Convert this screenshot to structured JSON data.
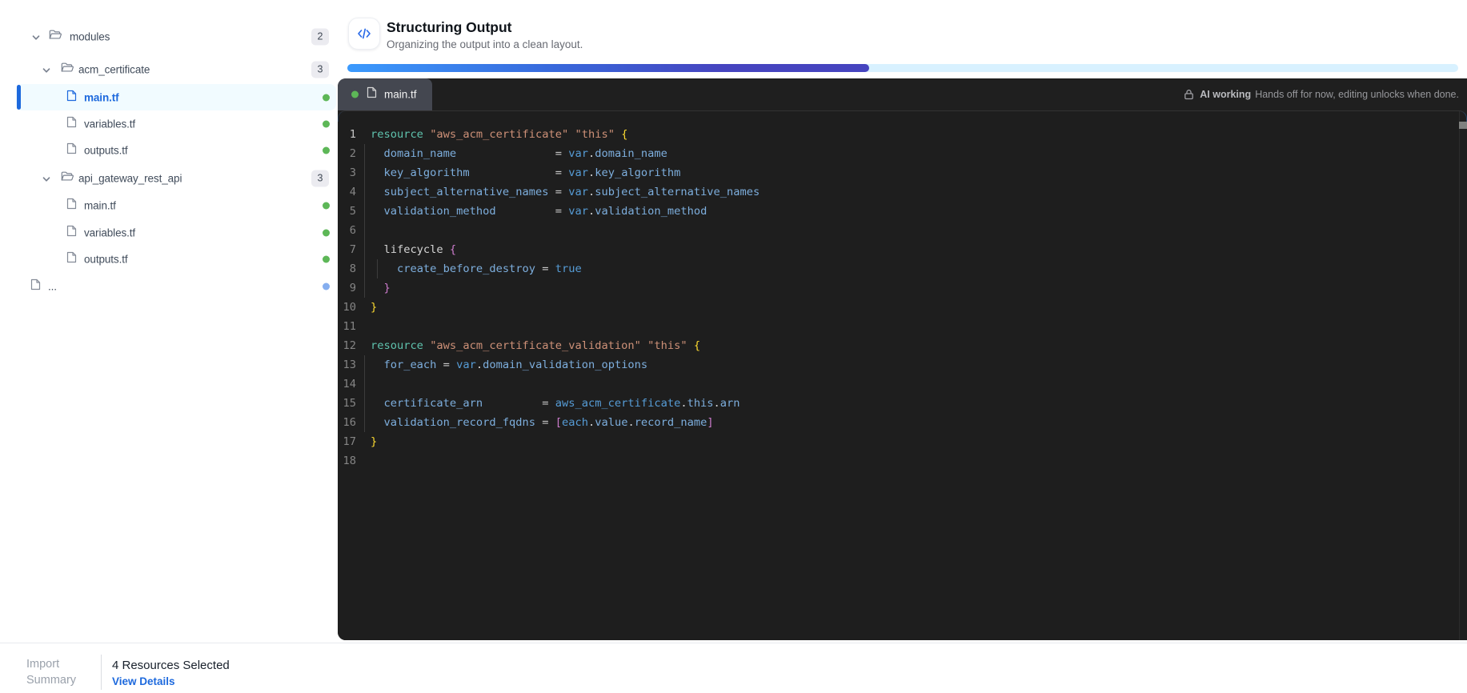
{
  "sidebar": {
    "tree": [
      {
        "type": "folder",
        "level": 0,
        "label": "modules",
        "badge": "2",
        "expanded": true
      },
      {
        "type": "folder",
        "level": 1,
        "label": "acm_certificate",
        "badge": "3",
        "expanded": true
      },
      {
        "type": "file",
        "level": 2,
        "label": "main.tf",
        "selected": true,
        "dot": "green"
      },
      {
        "type": "file",
        "level": 2,
        "label": "variables.tf",
        "dot": "green"
      },
      {
        "type": "file",
        "level": 2,
        "label": "outputs.tf",
        "dot": "green"
      },
      {
        "type": "folder",
        "level": 1,
        "label": "api_gateway_rest_api",
        "badge": "3",
        "expanded": true
      },
      {
        "type": "file",
        "level": 2,
        "label": "main.tf",
        "dot": "green"
      },
      {
        "type": "file",
        "level": 2,
        "label": "variables.tf",
        "dot": "green"
      },
      {
        "type": "file",
        "level": 2,
        "label": "outputs.tf",
        "dot": "green"
      },
      {
        "type": "file",
        "level": 0,
        "label": "...",
        "dot": "blue"
      }
    ]
  },
  "header": {
    "icon": "code-icon",
    "title": "Structuring Output",
    "subtitle": "Organizing the output into a clean layout.",
    "progress_percent": 47,
    "accent_gradient": [
      "#3b9afd",
      "#3868db",
      "#4644bf"
    ],
    "track_color": "#d8f1ff"
  },
  "editor": {
    "tab": {
      "label": "main.tf",
      "dot": "green",
      "icon": "file-icon"
    },
    "lock": {
      "icon": "lock-icon",
      "bold": "AI working",
      "text": "Hands off for now, editing unlocks when done."
    },
    "background": "#1e1e1e",
    "token_colors": {
      "kw": "#5fc3ae",
      "str": "#ce9178",
      "b1": "#fcda30",
      "b2": "#cd7ccd",
      "prop": "#7daedd",
      "ref": "#569cd6",
      "d": "#d4d4d4",
      "op": "#c8c8c8"
    },
    "lines": [
      {
        "n": 1,
        "active": true,
        "g": 0,
        "seg": [
          [
            "kw",
            "resource"
          ],
          [
            "d",
            " "
          ],
          [
            "str",
            "\"aws_acm_certificate\""
          ],
          [
            "d",
            " "
          ],
          [
            "str",
            "\"this\""
          ],
          [
            "d",
            " "
          ],
          [
            "b1",
            "{"
          ]
        ]
      },
      {
        "n": 2,
        "g": 1,
        "seg": [
          [
            "d",
            "  "
          ],
          [
            "prop",
            "domain_name"
          ],
          [
            "d",
            "               "
          ],
          [
            "op",
            "= "
          ],
          [
            "ref",
            "var"
          ],
          [
            "d",
            "."
          ],
          [
            "prop",
            "domain_name"
          ]
        ]
      },
      {
        "n": 3,
        "g": 1,
        "seg": [
          [
            "d",
            "  "
          ],
          [
            "prop",
            "key_algorithm"
          ],
          [
            "d",
            "             "
          ],
          [
            "op",
            "= "
          ],
          [
            "ref",
            "var"
          ],
          [
            "d",
            "."
          ],
          [
            "prop",
            "key_algorithm"
          ]
        ]
      },
      {
        "n": 4,
        "g": 1,
        "seg": [
          [
            "d",
            "  "
          ],
          [
            "prop",
            "subject_alternative_names"
          ],
          [
            "d",
            " "
          ],
          [
            "op",
            "= "
          ],
          [
            "ref",
            "var"
          ],
          [
            "d",
            "."
          ],
          [
            "prop",
            "subject_alternative_names"
          ]
        ]
      },
      {
        "n": 5,
        "g": 1,
        "seg": [
          [
            "d",
            "  "
          ],
          [
            "prop",
            "validation_method"
          ],
          [
            "d",
            "         "
          ],
          [
            "op",
            "= "
          ],
          [
            "ref",
            "var"
          ],
          [
            "d",
            "."
          ],
          [
            "prop",
            "validation_method"
          ]
        ]
      },
      {
        "n": 6,
        "g": 1,
        "seg": []
      },
      {
        "n": 7,
        "g": 1,
        "seg": [
          [
            "d",
            "  lifecycle "
          ],
          [
            "b2",
            "{"
          ]
        ]
      },
      {
        "n": 8,
        "g": 2,
        "seg": [
          [
            "d",
            "    "
          ],
          [
            "prop",
            "create_before_destroy"
          ],
          [
            "op",
            " = "
          ],
          [
            "ref",
            "true"
          ]
        ]
      },
      {
        "n": 9,
        "g": 1,
        "seg": [
          [
            "d",
            "  "
          ],
          [
            "b2",
            "}"
          ]
        ]
      },
      {
        "n": 10,
        "g": 0,
        "seg": [
          [
            "b1",
            "}"
          ]
        ]
      },
      {
        "n": 11,
        "g": 0,
        "seg": []
      },
      {
        "n": 12,
        "g": 0,
        "seg": [
          [
            "kw",
            "resource"
          ],
          [
            "d",
            " "
          ],
          [
            "str",
            "\"aws_acm_certificate_validation\""
          ],
          [
            "d",
            " "
          ],
          [
            "str",
            "\"this\""
          ],
          [
            "d",
            " "
          ],
          [
            "b1",
            "{"
          ]
        ]
      },
      {
        "n": 13,
        "g": 1,
        "seg": [
          [
            "d",
            "  "
          ],
          [
            "prop",
            "for_each"
          ],
          [
            "op",
            " = "
          ],
          [
            "ref",
            "var"
          ],
          [
            "d",
            "."
          ],
          [
            "prop",
            "domain_validation_options"
          ]
        ]
      },
      {
        "n": 14,
        "g": 1,
        "seg": []
      },
      {
        "n": 15,
        "g": 1,
        "seg": [
          [
            "d",
            "  "
          ],
          [
            "prop",
            "certificate_arn"
          ],
          [
            "d",
            "         "
          ],
          [
            "op",
            "= "
          ],
          [
            "ref",
            "aws_acm_certificate"
          ],
          [
            "d",
            "."
          ],
          [
            "prop",
            "this"
          ],
          [
            "d",
            "."
          ],
          [
            "prop",
            "arn"
          ]
        ]
      },
      {
        "n": 16,
        "g": 1,
        "seg": [
          [
            "d",
            "  "
          ],
          [
            "prop",
            "validation_record_fqdns"
          ],
          [
            "op",
            " = "
          ],
          [
            "b2",
            "["
          ],
          [
            "ref",
            "each"
          ],
          [
            "d",
            "."
          ],
          [
            "prop",
            "value"
          ],
          [
            "d",
            "."
          ],
          [
            "prop",
            "record_name"
          ],
          [
            "b2",
            "]"
          ]
        ]
      },
      {
        "n": 17,
        "g": 0,
        "seg": [
          [
            "b1",
            "}"
          ]
        ]
      },
      {
        "n": 18,
        "g": 0,
        "seg": []
      }
    ]
  },
  "footer": {
    "label_line1": "Import",
    "label_line2": "Summary",
    "resources_selected": "4 Resources Selected",
    "view_details": "View Details"
  }
}
